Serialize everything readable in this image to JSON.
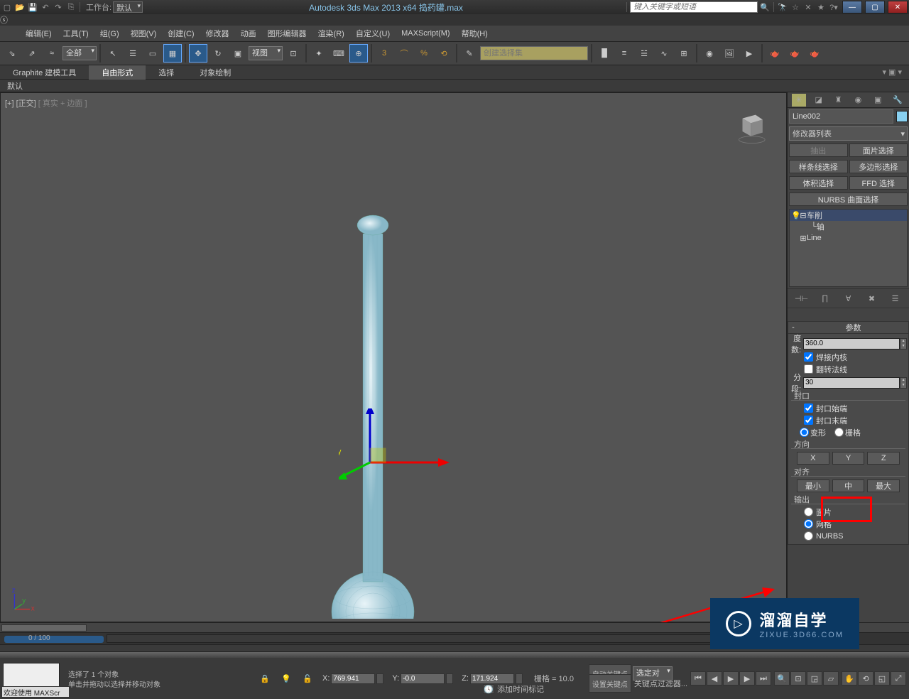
{
  "titlebar": {
    "workspace_label": "工作台:",
    "workspace_value": "默认",
    "app_title": "Autodesk 3ds Max  2013 x64     捣药罐.max",
    "search_placeholder": "键入关键字或短语"
  },
  "menu": {
    "items": [
      "编辑(E)",
      "工具(T)",
      "组(G)",
      "视图(V)",
      "创建(C)",
      "修改器",
      "动画",
      "图形编辑器",
      "渲染(R)",
      "自定义(U)",
      "MAXScript(M)",
      "帮助(H)"
    ]
  },
  "toolbar": {
    "select_set": "全部",
    "view_dd": "视图",
    "create_set_ph": "创建选择集"
  },
  "ribbon": {
    "tabs": [
      "Graphite 建模工具",
      "自由形式",
      "选择",
      "对象绘制"
    ],
    "active": 1,
    "row2": "默认"
  },
  "viewport": {
    "label_main": "[+] [正交]",
    "label_sub": "[ 真实 + 边面 ]"
  },
  "sidepanel": {
    "obj_name": "Line002",
    "mod_dd": "修改器列表",
    "btns": {
      "r1": [
        "抽出",
        "面片选择"
      ],
      "r2": [
        "样条线选择",
        "多边形选择"
      ],
      "r3": [
        "体积选择",
        "FFD 选择"
      ],
      "r4": "NURBS 曲面选择"
    },
    "stack": [
      {
        "name": "车削",
        "sel": true,
        "exp": "⊟",
        "eye": "💡"
      },
      {
        "name": "轴",
        "sub": true
      },
      {
        "name": "Line",
        "exp": "⊞"
      }
    ]
  },
  "params": {
    "title": "参数",
    "degree_lab": "度数:",
    "degree_val": "360.0",
    "weld": "焊接内核",
    "flip": "翻转法线",
    "seg_lab": "分段:",
    "seg_val": "30",
    "cap_title": "封口",
    "cap_start": "封口始端",
    "cap_end": "封口末端",
    "cap_morph": "变形",
    "cap_grid": "栅格",
    "dir_title": "方向",
    "dir": [
      "X",
      "Y",
      "Z"
    ],
    "align_title": "对齐",
    "align": [
      "最小",
      "中",
      "最大"
    ],
    "out_title": "输出",
    "out": [
      "面片",
      "网格",
      "NURBS"
    ]
  },
  "timeline": {
    "counter": "0 / 100"
  },
  "status": {
    "line1": "选择了 1 个对象",
    "line2": "单击并拖动以选择并移动对象",
    "welcome": "欢迎使用  MAXScr",
    "x": "769.941",
    "y": "-0.0",
    "z": "171.924",
    "grid_lab": "栅格",
    "grid_val": "= 10.0",
    "autokey": "自动关键点",
    "selset": "选定对",
    "setkey": "设置关键点",
    "keyfilter": "关键点过滤器...",
    "addtime": "添加时间标记"
  },
  "watermark": {
    "main": "溜溜自学",
    "sub": "ZIXUE.3D66.COM"
  }
}
